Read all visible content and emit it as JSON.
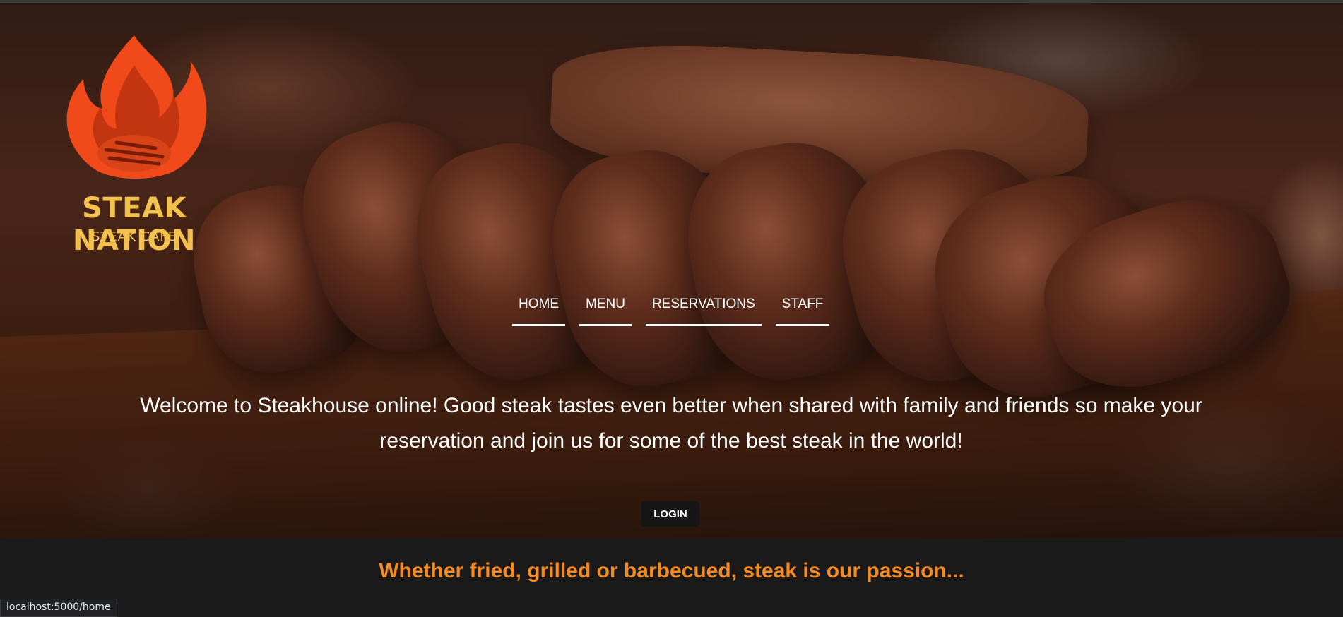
{
  "brand": {
    "name": "STEAK NATION",
    "tagline": "STEAK CAFE",
    "icon": "flame-steak-icon",
    "colors": {
      "flame": "#f04a1a",
      "text": "#f2c14e"
    }
  },
  "nav": {
    "items": [
      {
        "label": "HOME"
      },
      {
        "label": "MENU"
      },
      {
        "label": "RESERVATIONS"
      },
      {
        "label": "STAFF"
      }
    ]
  },
  "hero": {
    "welcome": "Welcome to Steakhouse online! Good steak tastes even better when shared with family and friends so make your reservation and join us for some of the best steak in the world!",
    "login_label": "LOGIN"
  },
  "section": {
    "tagline": "Whether fried, grilled or barbecued, steak is our passion...",
    "color": "#f58a1f"
  },
  "statusbar": {
    "url": "localhost:5000/home"
  }
}
